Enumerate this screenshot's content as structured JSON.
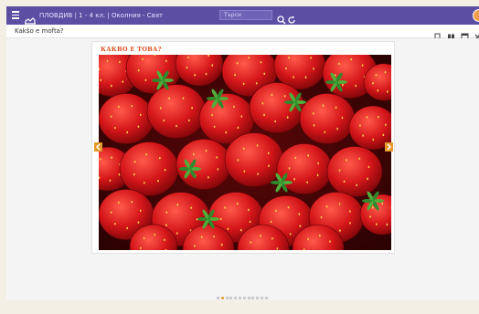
{
  "topbar": {
    "breadcrumb": "ПЛОВДИВ | 1 - 4 кл. | Околния - Свят",
    "search_placeholder": "Търси",
    "accent": "#5b4ea3"
  },
  "subbar": {
    "page_title": "Kakšo e mofta?"
  },
  "card": {
    "title": "КАКВО Е ТОВА?",
    "image_subject": "strawberries"
  },
  "carousel": {
    "total": 12,
    "active_index": 1,
    "arrow_color": "#e49a2a"
  },
  "icons": [
    "menu-icon",
    "logo-icon",
    "search-icon",
    "refresh-icon",
    "bookmark-icon",
    "book-icon",
    "window-icon",
    "close-icon",
    "prev-arrow-icon",
    "next-arrow-icon",
    "avatar"
  ]
}
